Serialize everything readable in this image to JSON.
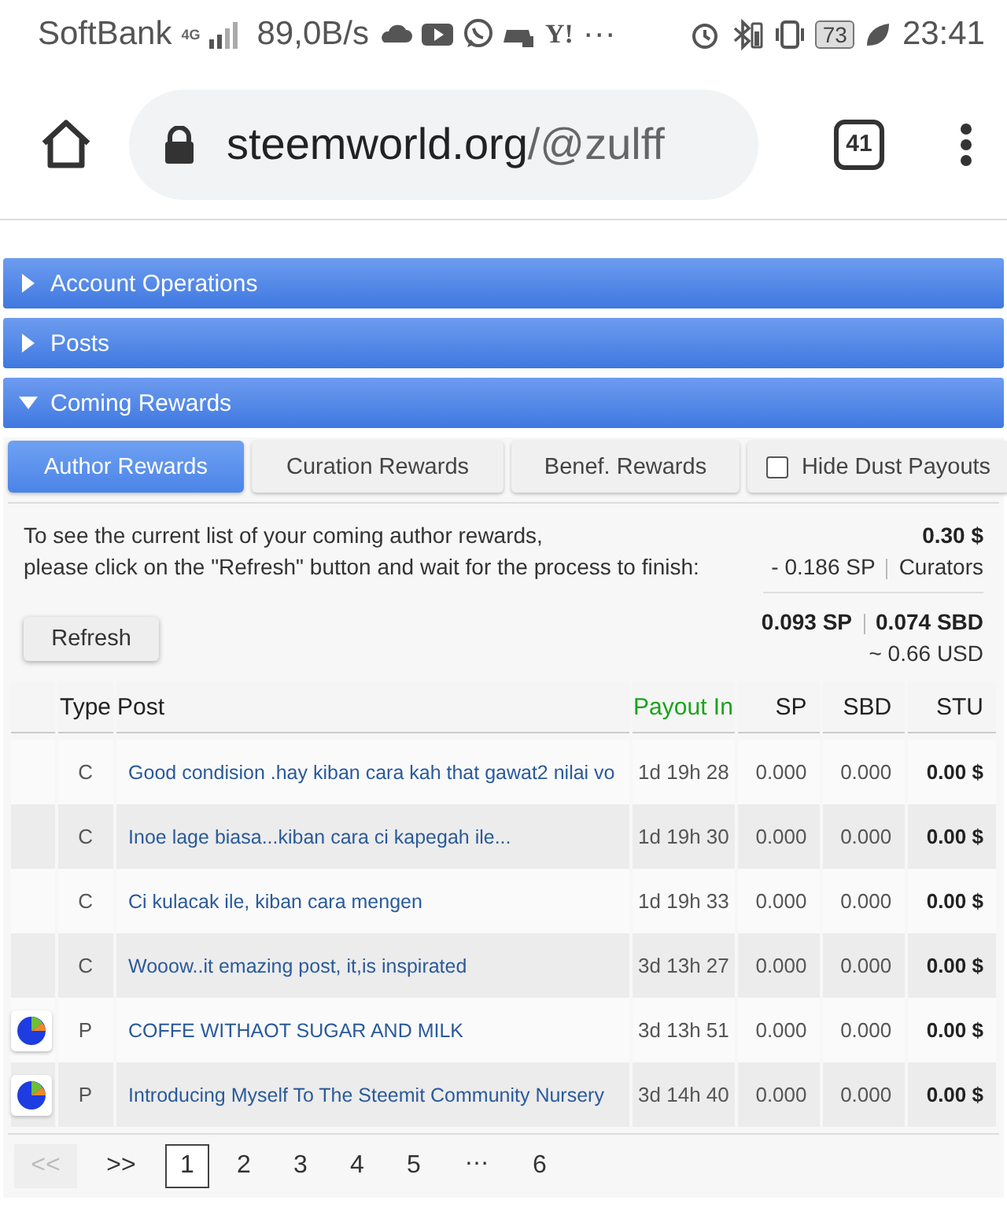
{
  "status_bar": {
    "carrier": "SoftBank",
    "network": "4G",
    "speed": "89,0B/s",
    "app_text": "Y!",
    "more": "···",
    "battery": "73",
    "time": "23:41"
  },
  "browser": {
    "url_host": "steemworld.org",
    "url_path": "/@zulff",
    "tab_count": "41"
  },
  "sections": [
    {
      "title": "Account Operations",
      "expanded": false
    },
    {
      "title": "Posts",
      "expanded": false
    },
    {
      "title": "Coming Rewards",
      "expanded": true
    }
  ],
  "reward_tabs": [
    {
      "label": "Author Rewards",
      "selected": true
    },
    {
      "label": "Curation Rewards",
      "selected": false
    },
    {
      "label": "Benef. Rewards",
      "selected": false
    }
  ],
  "hide_dust": {
    "label": "Hide Dust Payouts",
    "checked": false
  },
  "info": {
    "line_1": "To see the current list of your coming author rewards,",
    "line_2": "please click on the \"Refresh\" button and wait for the process to finish:",
    "total": "0.30 $",
    "curators_sp": "- 0.186 SP",
    "curators_label": "Curators",
    "sp": "0.093 SP",
    "sbd": "0.074 SBD",
    "usd": "~ 0.66 USD"
  },
  "refresh_button": "Refresh",
  "table": {
    "columns": [
      {
        "label": "Type",
        "sorted": false
      },
      {
        "label": "Post",
        "sorted": false
      },
      {
        "label": "Payout In",
        "sorted": true
      },
      {
        "label": "SP",
        "sorted": false
      },
      {
        "label": "SBD",
        "sorted": false
      },
      {
        "label": "STU",
        "sorted": false
      }
    ],
    "rows": [
      {
        "kind": "comment",
        "type": "C",
        "post": "Good condision .hay kiban cara kah that gawat2 nilai vo",
        "payout_in": "1d 19h 28",
        "sp": "0.000",
        "sbd": "0.000",
        "stu": "0.00 $"
      },
      {
        "kind": "comment",
        "type": "C",
        "post": "Inoe lage biasa...kiban cara ci kapegah ile...",
        "payout_in": "1d 19h 30",
        "sp": "0.000",
        "sbd": "0.000",
        "stu": "0.00 $"
      },
      {
        "kind": "comment",
        "type": "C",
        "post": "Ci kulacak ile, kiban cara mengen",
        "payout_in": "1d 19h 33",
        "sp": "0.000",
        "sbd": "0.000",
        "stu": "0.00 $"
      },
      {
        "kind": "comment",
        "type": "C",
        "post": "Wooow..it emazing post, it,is inspirated",
        "payout_in": "3d 13h 27",
        "sp": "0.000",
        "sbd": "0.000",
        "stu": "0.00 $"
      },
      {
        "kind": "post",
        "type": "P",
        "post": "COFFE WITHAOT SUGAR AND MILK",
        "payout_in": "3d 13h 51",
        "sp": "0.000",
        "sbd": "0.000",
        "stu": "0.00 $"
      },
      {
        "kind": "post",
        "type": "P",
        "post": "Introducing Myself To The Steemit Community Nursery",
        "payout_in": "3d 14h 40",
        "sp": "0.000",
        "sbd": "0.000",
        "stu": "0.00 $"
      }
    ]
  },
  "pagination": [
    {
      "label": "<<",
      "kind": "nav",
      "disabled": true
    },
    {
      "label": ">>",
      "kind": "nav",
      "disabled": false
    },
    {
      "label": "1",
      "kind": "page",
      "selected": true
    },
    {
      "label": "2",
      "kind": "page",
      "selected": false
    },
    {
      "label": "3",
      "kind": "page",
      "selected": false
    },
    {
      "label": "4",
      "kind": "page",
      "selected": false
    },
    {
      "label": "5",
      "kind": "page",
      "selected": false
    },
    {
      "label": "…",
      "kind": "gap"
    },
    {
      "label": "6",
      "kind": "page",
      "selected": false
    }
  ]
}
